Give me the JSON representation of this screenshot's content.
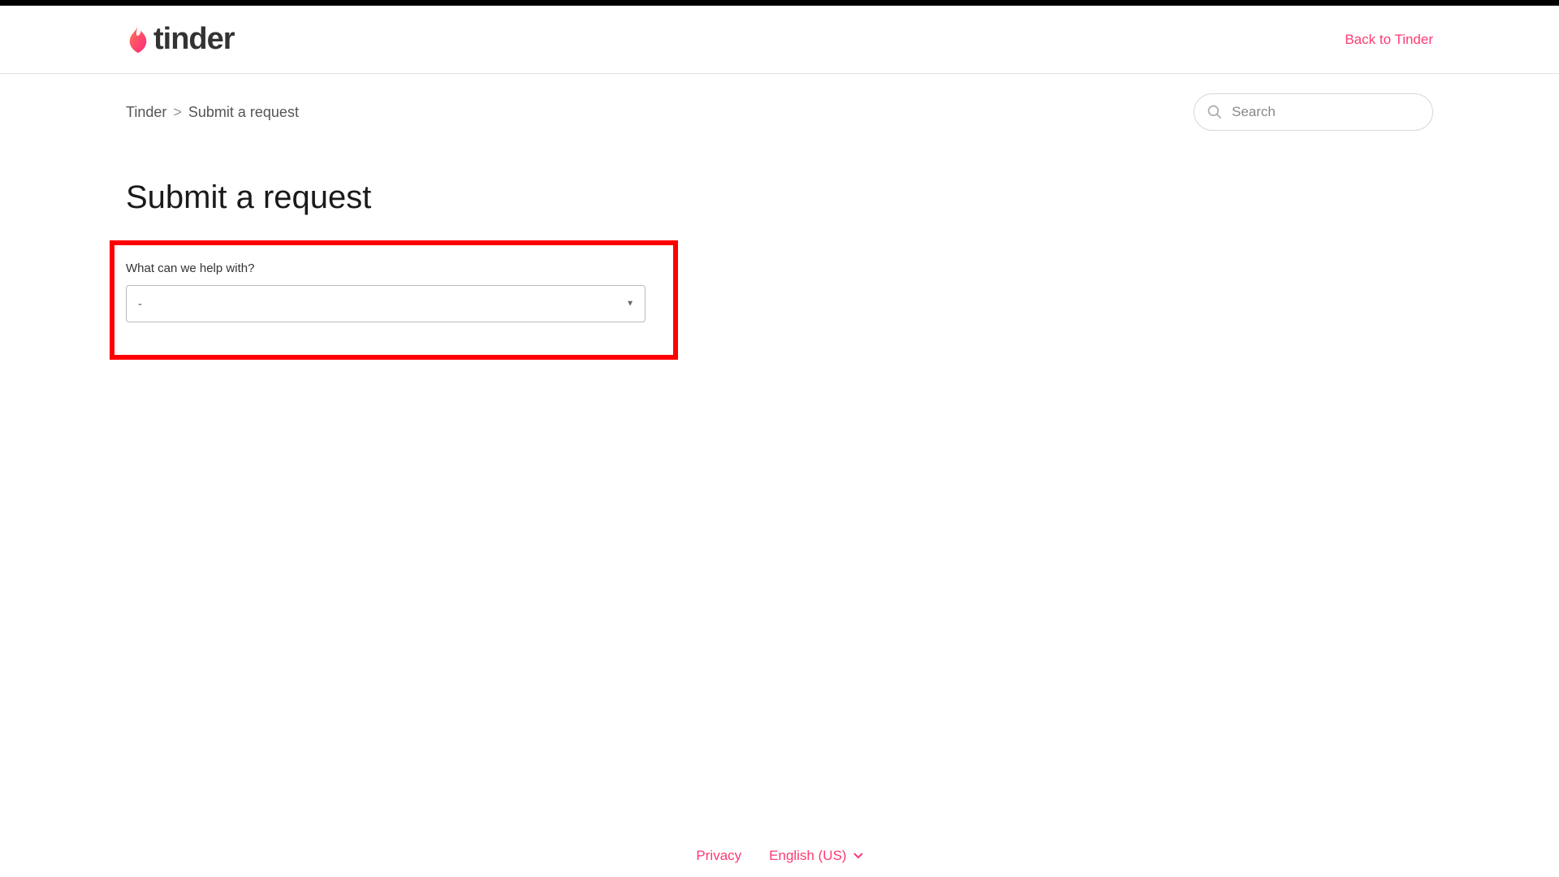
{
  "header": {
    "logo_text": "tinder",
    "back_link": "Back to Tinder"
  },
  "breadcrumb": {
    "root": "Tinder",
    "separator": ">",
    "current": "Submit a request"
  },
  "search": {
    "placeholder": "Search"
  },
  "main": {
    "title": "Submit a request",
    "help_label": "What can we help with?",
    "select_value": "-"
  },
  "footer": {
    "privacy": "Privacy",
    "language": "English (US)"
  }
}
